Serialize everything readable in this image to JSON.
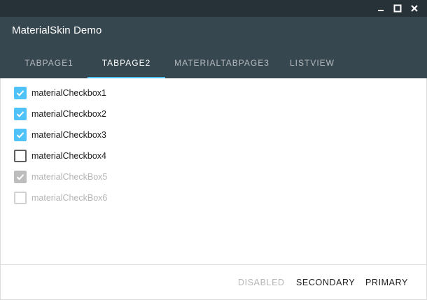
{
  "window": {
    "title": "MaterialSkin Demo",
    "controls": [
      {
        "name": "minimize-icon"
      },
      {
        "name": "maximize-icon"
      },
      {
        "name": "close-icon"
      }
    ]
  },
  "colors": {
    "titlebar": "#263238",
    "appbar": "#37474f",
    "accent": "#4fc3f7",
    "disabled": "#bdbdbd"
  },
  "tabs": [
    {
      "label": "TABPAGE1",
      "active": false
    },
    {
      "label": "TABPAGE2",
      "active": true
    },
    {
      "label": "MATERIALTABPAGE3",
      "active": false
    },
    {
      "label": "LISTVIEW",
      "active": false
    }
  ],
  "checkboxes": [
    {
      "label": "materialCheckbox1",
      "checked": true,
      "enabled": true
    },
    {
      "label": "materialCheckbox2",
      "checked": true,
      "enabled": true
    },
    {
      "label": "materialCheckbox3",
      "checked": true,
      "enabled": true
    },
    {
      "label": "materialCheckbox4",
      "checked": false,
      "enabled": true
    },
    {
      "label": "materialCheckBox5",
      "checked": true,
      "enabled": false
    },
    {
      "label": "materialCheckBox6",
      "checked": false,
      "enabled": false
    }
  ],
  "footer": {
    "disabled_label": "DISABLED",
    "secondary_label": "SECONDARY",
    "primary_label": "PRIMARY"
  }
}
